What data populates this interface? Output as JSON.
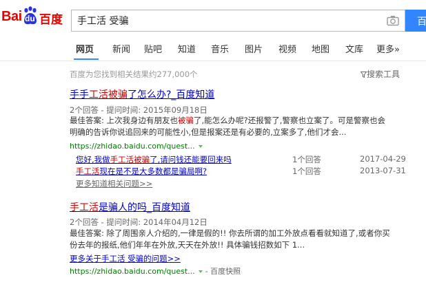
{
  "logo": {
    "bai": "Bai",
    "du": "du",
    "cn": "百度"
  },
  "search": {
    "query": "手工活 受骗",
    "button": "百"
  },
  "tabs": [
    "网页",
    "新闻",
    "贴吧",
    "知道",
    "音乐",
    "图片",
    "视频",
    "地图",
    "文库",
    "更多»"
  ],
  "result_count": "百度为您找到相关结果约277,000个",
  "tools_label": "搜索工具",
  "results": [
    {
      "title_pre": "手手",
      "title_em1": "工活被骗",
      "title_post": "了怎么办?_百度知道",
      "meta": "2个回答 - 提问时间: 2015年09月18日",
      "abs_1_pre": "最佳答案: 上次我身边有朋友也",
      "abs_1_em": "被骗",
      "abs_1_post": "了,能怎么办呢?还报警了,警察也立案了。可是警察也会",
      "abs_2": "明确的告诉你说追回来的可能性小,但是报案还是有必要的,立案多了,他们才会...",
      "url": "https://zhidao.baidu.com/quest...",
      "subs": [
        {
          "pre": "您好,我做",
          "em": "手工活被骗",
          "post": "了,请问钱还能要回来吗",
          "answers": "1个回答",
          "date": "2017-04-29"
        },
        {
          "pre": "",
          "em": "手工活",
          "post": "现在是不是大多数都是骗局啊?",
          "answers": "1个回答",
          "date": "2013-07-31"
        }
      ],
      "more": "更多知道相关问题>>"
    },
    {
      "title_em1": "手工活",
      "title_post": "是骗人的吗_百度知道",
      "meta": "2个回答 - 提问时间: 2014年04月12日",
      "abs_1": "最佳答案: 除了周围亲人介绍的,一律是假的!! 你去所谓的加工外放点看看就知道了,或者你买",
      "abs_2": "份去年的报纸,他们年年在外放,天天在外放!! 具体骗钱招数如下 1...",
      "more": "更多关于手工活 受骗的问题>>",
      "url": "https://zhidao.baidu.com/quest...",
      "snapshot": "- 百度快照"
    }
  ],
  "colors": {
    "brand_red": "#e10601",
    "link_blue": "#0000cc",
    "url_green": "#008000",
    "button_blue": "#3385ff"
  }
}
